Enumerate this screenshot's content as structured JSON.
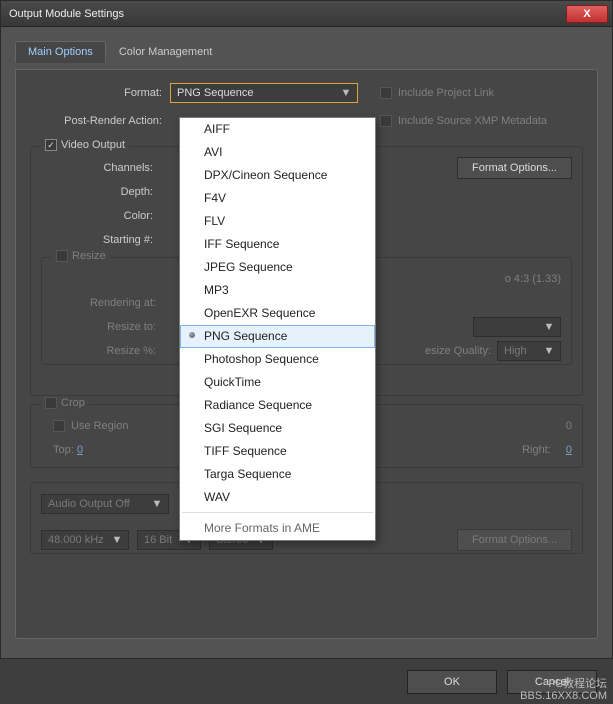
{
  "window": {
    "title": "Output Module Settings",
    "close": "X"
  },
  "tabs": {
    "main": "Main Options",
    "color": "Color Management"
  },
  "format": {
    "label": "Format:",
    "value": "PNG Sequence",
    "include_link": "Include Project Link",
    "post_render_label": "Post-Render Action:",
    "include_xmp": "Include Source XMP Metadata"
  },
  "video": {
    "title": "Video Output",
    "channels_label": "Channels:",
    "depth_label": "Depth:",
    "color_label": "Color:",
    "starting_label": "Starting #:",
    "format_options": "Format Options..."
  },
  "resize": {
    "title": "Resize",
    "lock_suffix": "o 4:3 (1.33)",
    "rendering_label": "Rendering at:",
    "resize_to_label": "Resize to:",
    "resize_pct_label": "Resize %:",
    "quality_label": "esize Quality:",
    "quality_value": "High"
  },
  "crop": {
    "title": "Crop",
    "use_region": "Use Region",
    "final_suffix": "0",
    "top_label": "Top:",
    "top_val": "0",
    "right_label": "Right:",
    "right_val": "0"
  },
  "audio": {
    "title": "Audio Output Off",
    "rate": "48.000 kHz",
    "depth": "16 Bit",
    "channels": "Stereo",
    "format_options": "Format Options..."
  },
  "footer": {
    "ok": "OK",
    "cancel": "Cancel"
  },
  "watermark": {
    "l1": "PS教程论坛",
    "l2": "BBS.16XX8.COM"
  },
  "dropdown": {
    "items": [
      "AIFF",
      "AVI",
      "DPX/Cineon Sequence",
      "F4V",
      "FLV",
      "IFF Sequence",
      "JPEG Sequence",
      "MP3",
      "OpenEXR Sequence",
      "PNG Sequence",
      "Photoshop Sequence",
      "QuickTime",
      "Radiance Sequence",
      "SGI Sequence",
      "TIFF Sequence",
      "Targa Sequence",
      "WAV"
    ],
    "selected": "PNG Sequence",
    "more": "More Formats in AME"
  }
}
